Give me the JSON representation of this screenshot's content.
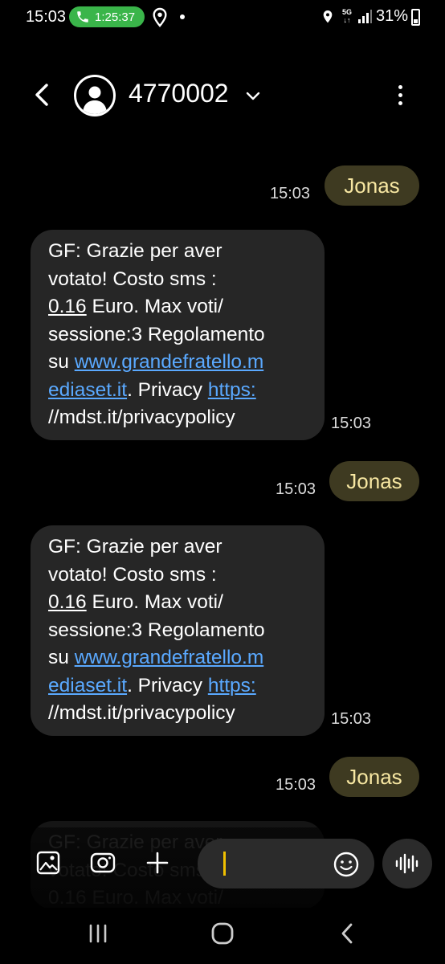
{
  "status_bar": {
    "time": "15:03",
    "call_timer": "1:25:37",
    "network": "5G",
    "battery": "31%",
    "accent_call_color": "#3ab54a"
  },
  "header": {
    "contact": "4770002",
    "back_icon": "back-arrow-icon",
    "more_icon": "more-vertical-icon"
  },
  "messages": {
    "sent_1": {
      "text": "Jonas",
      "time": "15:03"
    },
    "recv_1": {
      "lines": [
        [
          "GF: Grazie per aver"
        ],
        [
          "votato! Costo sms :"
        ],
        [
          "0.16",
          " Euro. Max voti/"
        ],
        [
          "sessione:3 Regolamento"
        ],
        [
          "su ",
          "www.grandefratello.m"
        ],
        [
          "ediaset.it",
          ". Privacy ",
          "https:"
        ],
        [
          "//mdst.it/privacypolicy"
        ]
      ],
      "time": "15:03"
    },
    "sent_2": {
      "text": "Jonas",
      "time": "15:03"
    },
    "recv_2": {
      "lines": [
        [
          "GF: Grazie per aver"
        ],
        [
          "votato! Costo sms :"
        ],
        [
          "0.16",
          " Euro. Max voti/"
        ],
        [
          "sessione:3 Regolamento"
        ],
        [
          "su ",
          "www.grandefratello.m"
        ],
        [
          "ediaset.it",
          ". Privacy ",
          "https:"
        ],
        [
          "//mdst.it/privacypolicy"
        ]
      ],
      "time": "15:03"
    },
    "sent_3": {
      "text": "Jonas",
      "time": "15:03"
    },
    "recv_3_partial": {
      "lines": [
        [
          "GF: Grazie per aver"
        ],
        [
          "votato! Costo sms :"
        ],
        [
          "0.16 Euro. Max voti/"
        ]
      ]
    }
  },
  "colors": {
    "sent_bubble": "#3e3a21",
    "sent_text": "#f7e7a2",
    "recv_bubble": "#262626",
    "link": "#5aa9ff",
    "caret": "#f0c000"
  },
  "input_bar": {
    "gallery_icon": "gallery-icon",
    "camera_icon": "camera-icon",
    "add_icon": "plus-icon",
    "emoji_icon": "emoji-icon",
    "voice_icon": "voice-waveform-icon"
  },
  "nav_bar": {
    "recents_icon": "recents-icon",
    "home_icon": "home-icon",
    "back_icon": "nav-back-icon"
  }
}
